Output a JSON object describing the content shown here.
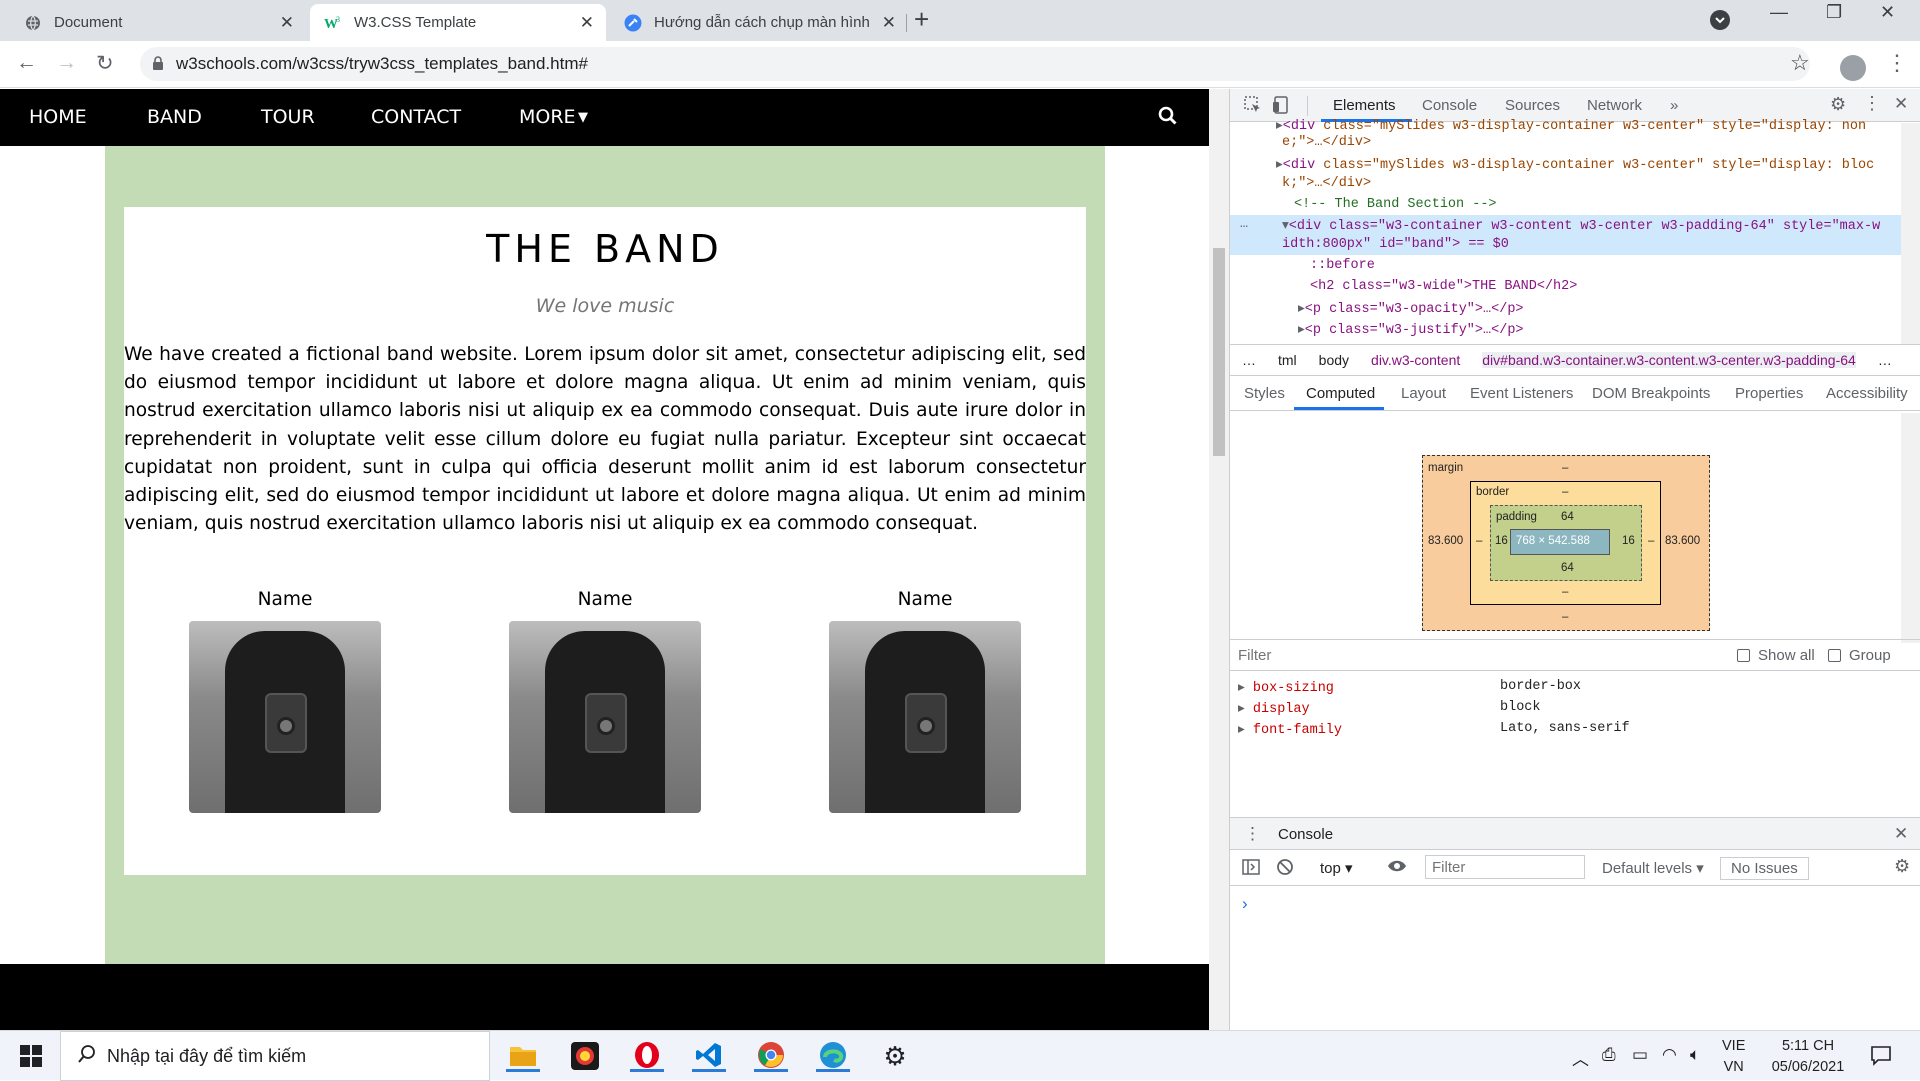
{
  "browser": {
    "tabs": [
      {
        "title": "Document",
        "icon": "globe-icon"
      },
      {
        "title": "W3.CSS Template",
        "icon": "w3schools-icon",
        "active": true
      },
      {
        "title": "Hướng dẫn cách chụp màn hình",
        "icon": "tool-icon"
      }
    ],
    "new_tab": "+",
    "url": "w3schools.com/w3css/tryw3css_templates_band.htm#"
  },
  "website": {
    "nav": [
      "HOME",
      "BAND",
      "TOUR",
      "CONTACT",
      "MORE"
    ],
    "band_title": "THE BAND",
    "band_subtitle": "We love music",
    "band_text": "We have created a fictional band website. Lorem ipsum dolor sit amet, consectetur adipiscing elit, sed do eiusmod tempor incididunt ut labore et dolore magna aliqua. Ut enim ad minim veniam, quis nostrud exercitation ullamco laboris nisi ut aliquip ex ea commodo consequat. Duis aute irure dolor in reprehenderit in voluptate velit esse cillum dolore eu fugiat nulla pariatur. Excepteur sint occaecat cupidatat non proident, sunt in culpa qui officia deserunt mollit anim id est laborum consectetur adipiscing elit, sed do eiusmod tempor incididunt ut labore et dolore magna aliqua. Ut enim ad minim veniam, quis nostrud exercitation ullamco laboris nisi ut aliquip ex ea commodo consequat.",
    "members": [
      "Name",
      "Name",
      "Name"
    ],
    "colors": {
      "nav": "#000000",
      "band_bg": "#c3dcb5",
      "band_bar": "#4e6747"
    }
  },
  "devtools": {
    "tabs": [
      "Elements",
      "Console",
      "Sources",
      "Network",
      "»"
    ],
    "dom": {
      "l1_tag": "<div",
      "l1_attrs": "class=\"mySlides w3-display-container w3-center\" style=\"display: non",
      "l2": "e;\">…</div>",
      "l3_tag": "<div",
      "l3_attrs": "class=\"mySlides w3-display-container w3-center\" style=\"display: bloc",
      "l4": "k;\">…</div>",
      "l5": "<!-- The Band Section -->",
      "l6": "<div class=\"w3-container w3-content w3-center w3-padding-64\" style=\"max-w",
      "l7": "idth:800px\" id=\"band\"> == $0",
      "l8": "::before",
      "l9": "<h2 class=\"w3-wide\">THE BAND</h2>",
      "l10": "<p class=\"w3-opacity\">…</p>",
      "l11": "<p class=\"w3-justify\">…</p>",
      "ellipsis": "…"
    },
    "breadcrumbs": [
      "…",
      "tml",
      "body",
      "div.w3-content",
      "div#band.w3-container.w3-content.w3-center.w3-padding-64",
      "…"
    ],
    "subtabs": [
      "Styles",
      "Computed",
      "Layout",
      "Event Listeners",
      "DOM Breakpoints",
      "Properties",
      "Accessibility"
    ],
    "box_model": {
      "margin_label": "margin",
      "margin_top": "–",
      "margin_bottom": "–",
      "margin_left": "83.600",
      "margin_right": "83.600",
      "border_label": "border",
      "border_top": "–",
      "border_bottom": "–",
      "border_left": "–",
      "border_right": "–",
      "padding_label": "padding",
      "padding_top": "64",
      "padding_bottom": "64",
      "padding_left": "16",
      "padding_right": "16",
      "content": "768 × 542.588"
    },
    "filter_placeholder": "Filter",
    "show_all": "Show all",
    "group": "Group",
    "properties": [
      {
        "name": "box-sizing",
        "value": "border-box"
      },
      {
        "name": "display",
        "value": "block"
      },
      {
        "name": "font-family",
        "value": "Lato, sans-serif"
      }
    ],
    "console": {
      "title": "Console",
      "context": "top",
      "filter_placeholder": "Filter",
      "levels": "Default levels",
      "issues": "No Issues",
      "prompt": "›"
    }
  },
  "taskbar": {
    "search_placeholder": "Nhập tại đây để tìm kiếm",
    "lang_line1": "VIE",
    "lang_line2": "VN",
    "time": "5:11 CH",
    "date": "05/06/2021"
  }
}
